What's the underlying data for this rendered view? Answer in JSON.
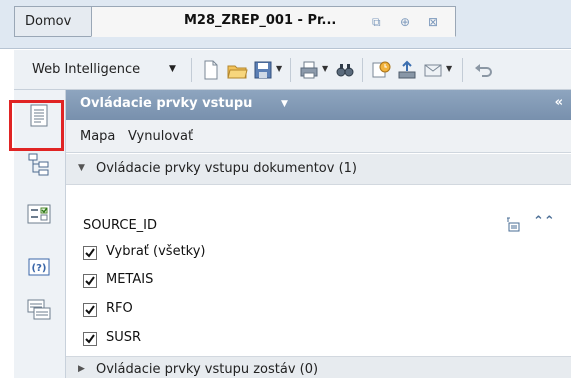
{
  "tabs": {
    "home": "Domov",
    "document": "M28_ZREP_001 - Pr..."
  },
  "toolbar": {
    "menu_label": "Web Intelligence"
  },
  "panel": {
    "title": "Ovládacie prvky vstupu",
    "menu": [
      "Mapa",
      "Vynulovať"
    ],
    "doc_section": "Ovládacie prvky vstupu dokumentov (1)",
    "report_section": "Ovládacie prvky vstupu zostáv (0)",
    "control": {
      "title": "SOURCE_ID",
      "options": [
        {
          "label": "Vybrať (všetky)",
          "checked": true
        },
        {
          "label": "METAIS",
          "checked": true
        },
        {
          "label": "RFO",
          "checked": true
        },
        {
          "label": "SUSR",
          "checked": true
        }
      ]
    }
  },
  "rail": {
    "icons": [
      "document-structure-icon",
      "navigation-map-icon",
      "input-controls-icon",
      "help-icon",
      "comments-icon"
    ],
    "selected": "input-controls-icon"
  },
  "colors": {
    "highlight": "#e02424",
    "panel_header": "#8ea5bf",
    "check": "#111111"
  }
}
